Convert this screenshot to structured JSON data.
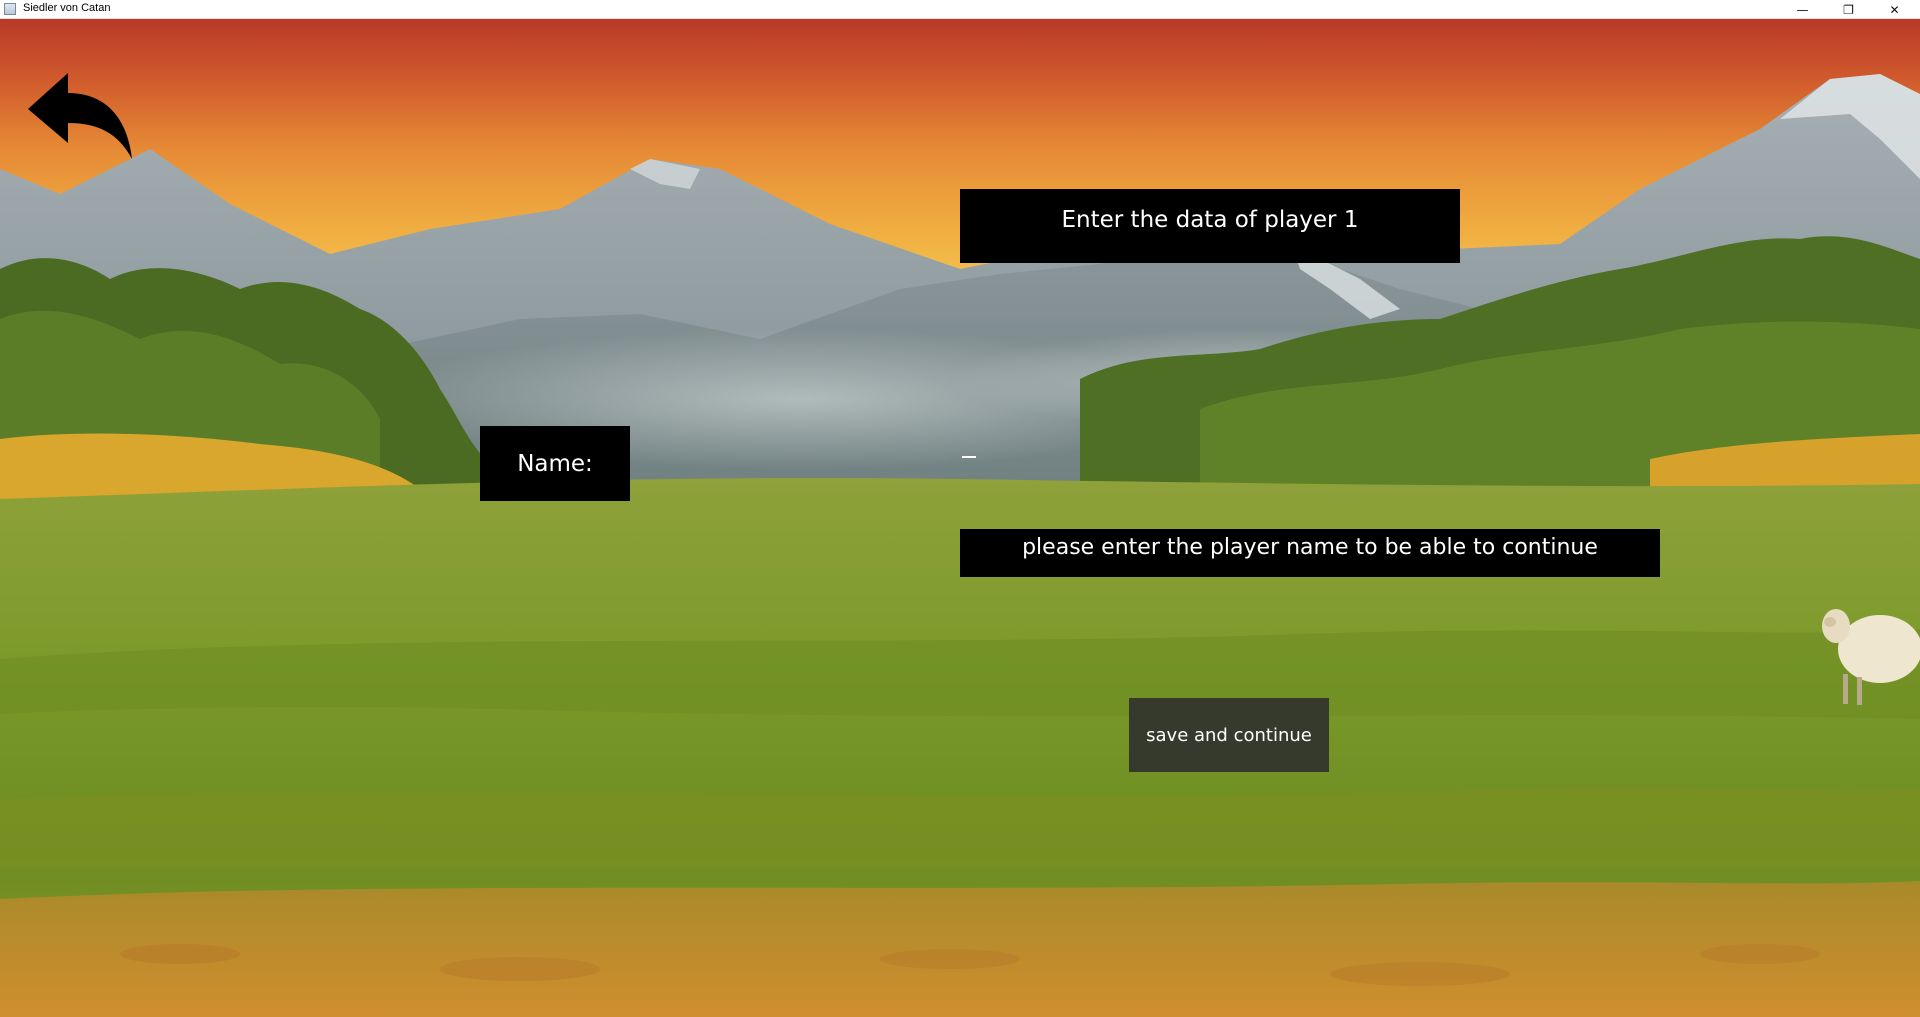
{
  "window": {
    "title": "Siedler von Catan",
    "controls": {
      "minimize": "—",
      "maximize": "❐",
      "close": "✕"
    }
  },
  "screen": {
    "header": "Enter the data of player 1",
    "name_label": "Name:",
    "name_input_value": "",
    "error_message": "please enter the player name to be able to continue",
    "save_button_label": "save and continue",
    "back_icon": "back-arrow-icon"
  },
  "colors": {
    "label_background": "#000000",
    "label_text": "#ffffff",
    "button_background": "#2d2d2d",
    "sky_top": "#b9392a",
    "sky_horizon": "#f3bf4f",
    "grass": "#7f9a2c",
    "dirt": "#c98a2a"
  }
}
